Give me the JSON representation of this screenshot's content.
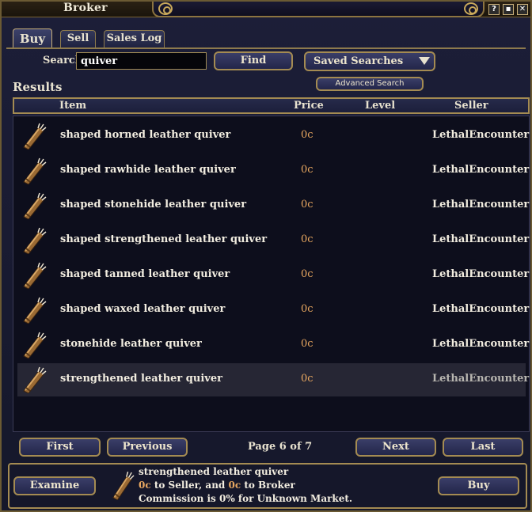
{
  "window": {
    "title": "Broker",
    "help_label": "?",
    "minimize_label": "▪",
    "close_label": "✕"
  },
  "tabs": [
    {
      "label": "Buy",
      "active": true
    },
    {
      "label": "Sell",
      "active": false
    },
    {
      "label": "Sales Log",
      "active": false
    }
  ],
  "search": {
    "label": "Search",
    "value": "quiver",
    "find_label": "Find",
    "saved_searches_label": "Saved Searches",
    "advanced_label": "Advanced Search"
  },
  "results": {
    "label": "Results",
    "columns": {
      "item": "Item",
      "price": "Price",
      "level": "Level",
      "seller": "Seller"
    },
    "rows": [
      {
        "name": "shaped horned leather quiver",
        "price": "0c",
        "level": "",
        "seller": "LethalEncounter"
      },
      {
        "name": "shaped rawhide leather quiver",
        "price": "0c",
        "level": "",
        "seller": "LethalEncounter"
      },
      {
        "name": "shaped stonehide leather quiver",
        "price": "0c",
        "level": "",
        "seller": "LethalEncounter"
      },
      {
        "name": "shaped strengthened leather quiver",
        "price": "0c",
        "level": "",
        "seller": "LethalEncounter"
      },
      {
        "name": "shaped tanned leather quiver",
        "price": "0c",
        "level": "",
        "seller": "LethalEncounter"
      },
      {
        "name": "shaped waxed leather quiver",
        "price": "0c",
        "level": "",
        "seller": "LethalEncounter"
      },
      {
        "name": "stonehide leather quiver",
        "price": "0c",
        "level": "",
        "seller": "LethalEncounter"
      },
      {
        "name": "strengthened leather quiver",
        "price": "0c",
        "level": "",
        "seller": "LethalEncounter",
        "selected": true
      }
    ]
  },
  "pager": {
    "first_label": "First",
    "previous_label": "Previous",
    "page_text": "Page 6 of 7",
    "next_label": "Next",
    "last_label": "Last"
  },
  "footer": {
    "examine_label": "Examine",
    "selected_name": "strengthened leather quiver",
    "seller_amount": "0c",
    "seller_text": " to Seller, and ",
    "broker_amount": "0c",
    "broker_text": " to Broker",
    "commission_text": "Commission is 0% for Unknown Market.",
    "buy_label": "Buy"
  },
  "colors": {
    "price": "#e9a860",
    "frame_gold": "#a48b52",
    "panel": "#1c1e38"
  },
  "icons": {
    "item": "quiver-icon",
    "title_left": "swirl-icon",
    "title_right": "swirl-icon"
  }
}
